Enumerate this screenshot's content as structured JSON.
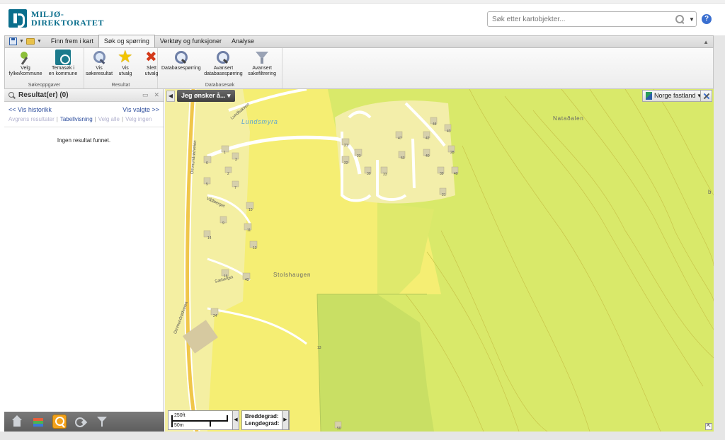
{
  "logo": {
    "line1": "MILJØ-",
    "line2": "DIREKTORATET"
  },
  "search": {
    "placeholder": "Søk etter kartobjekter..."
  },
  "ribbon": {
    "tabs": [
      {
        "label": "Finn frem i kart"
      },
      {
        "label": "Søk og spørring",
        "active": true
      },
      {
        "label": "Verktøy og funksjoner"
      },
      {
        "label": "Analyse"
      }
    ],
    "groups": [
      {
        "title": "Søkeoppgaver",
        "buttons": [
          {
            "label": "Velg\nfylke/kommune",
            "icon": "brush-icon"
          },
          {
            "label": "Temasøk i\nen kommune",
            "icon": "thematic-search-icon"
          }
        ]
      },
      {
        "title": "Resultat",
        "buttons": [
          {
            "label": "Vis\nsøkeresultat",
            "icon": "magnifier-icon"
          },
          {
            "label": "Vis\nutvalg",
            "icon": "star-icon"
          },
          {
            "label": "Slett\nutvalg",
            "icon": "delete-icon"
          }
        ]
      },
      {
        "title": "Databasesøk",
        "buttons": [
          {
            "label": "Databasespørring",
            "icon": "database-search-icon"
          },
          {
            "label": "Avansert\ndatabasespørring",
            "icon": "advanced-search-icon"
          },
          {
            "label": "Avansert\nsakefiltrering",
            "icon": "funnel-icon"
          }
        ]
      }
    ]
  },
  "results_panel": {
    "title": "Resultat(er) (0)",
    "history_link": "<< Vis historikk",
    "selected_link": "Vis valgte >>",
    "filters": {
      "narrow": "Avgrens resultater",
      "table": "Tabellvisning",
      "select_all": "Velg alle",
      "select_none": "Velg ingen"
    },
    "empty_text": "Ingen resultat funnet."
  },
  "map": {
    "want_button": "Jeg ønsker å...",
    "basemap": "Norge fastland",
    "place_names": {
      "lundsmyra": "Lundsmyra",
      "stolshaugen": "Stolshaugen",
      "natadalen": "Nataðalen",
      "b_edge": "b"
    },
    "road_names": {
      "lundbakken": "Lundbakken",
      "ommundrodveien": "Ommundrødveien",
      "vaaberget": "Vååberget",
      "saeberget": "Sæberget",
      "ommundrodveien_low": "Ommundrødveien"
    },
    "house_numbers": [
      "1",
      "3",
      "6",
      "2",
      "5",
      "7",
      "10",
      "9",
      "11",
      "14",
      "13",
      "16",
      "43",
      "24",
      "21",
      "23",
      "22",
      "30",
      "33",
      "47",
      "53",
      "42",
      "40",
      "44",
      "43",
      "28",
      "39",
      "40",
      "21",
      "50",
      "13"
    ],
    "scale": {
      "imperial": "250ft",
      "metric": "50m"
    },
    "coords": {
      "lat_label": "Breddegrad:",
      "lon_label": "Lengdegrad:"
    }
  },
  "colors": {
    "brand": "#0a6e8c",
    "map_yellow": "#f5ee73",
    "map_green": "#d9e96a",
    "map_dark_green": "#c4dc5c",
    "residential": "#f3eeaa"
  }
}
